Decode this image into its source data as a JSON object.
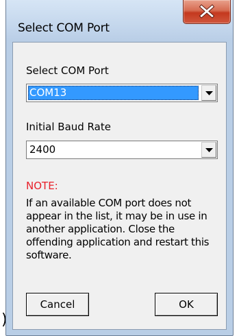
{
  "window": {
    "title": "Select COM Port",
    "close_glyph": "X"
  },
  "stray_text": ")",
  "com_port": {
    "label": "Select COM Port",
    "selected_value": "COM13"
  },
  "baud_rate": {
    "label": "Initial Baud Rate",
    "selected_value": "2400"
  },
  "note": {
    "title": "NOTE:",
    "body": "If an available COM port does not appear in the list, it may be in use in another application.  Close the offending application and restart this software."
  },
  "buttons": {
    "cancel_label": "Cancel",
    "ok_label": "OK"
  },
  "colors": {
    "note_title": "#e8202a",
    "selection_highlight": "#3399ff",
    "close_button": "#c4391f"
  },
  "icons": {
    "close": "close-icon",
    "dropdown": "chevron-down-icon"
  }
}
